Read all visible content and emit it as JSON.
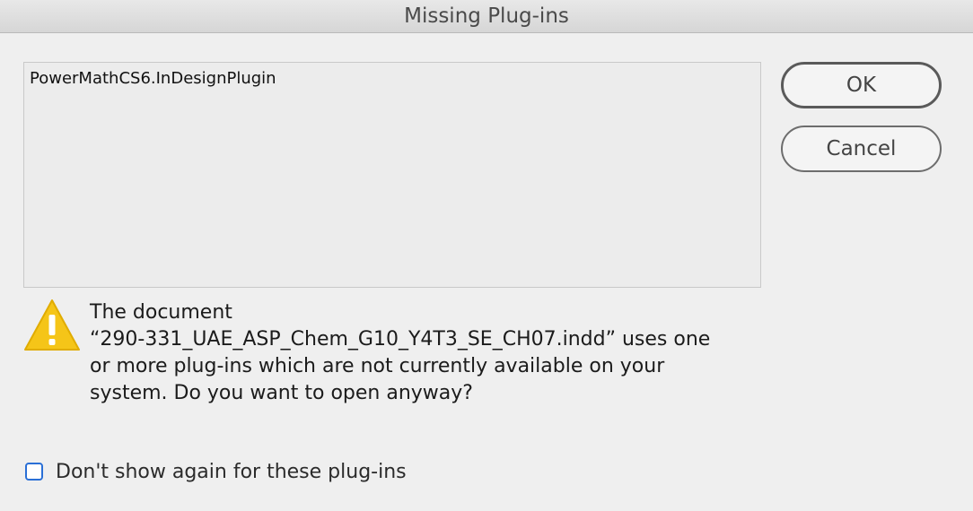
{
  "window": {
    "title": "Missing Plug-ins"
  },
  "plugins": {
    "items": [
      "PowerMathCS6.InDesignPlugin"
    ]
  },
  "buttons": {
    "ok_label": "OK",
    "cancel_label": "Cancel"
  },
  "message": {
    "line1": "The document",
    "line2": "“290-331_UAE_ASP_Chem_G10_Y4T3_SE_CH07.indd” uses one",
    "line3": "or more plug-ins which are not currently available on your",
    "line4": "system. Do you want to open anyway?"
  },
  "checkbox": {
    "label": "Don't show again for these plug-ins",
    "checked": false
  },
  "icons": {
    "warning": "warning-icon"
  },
  "colors": {
    "warning_yellow": "#f5c518",
    "checkbox_accent": "#2a6fd6"
  }
}
